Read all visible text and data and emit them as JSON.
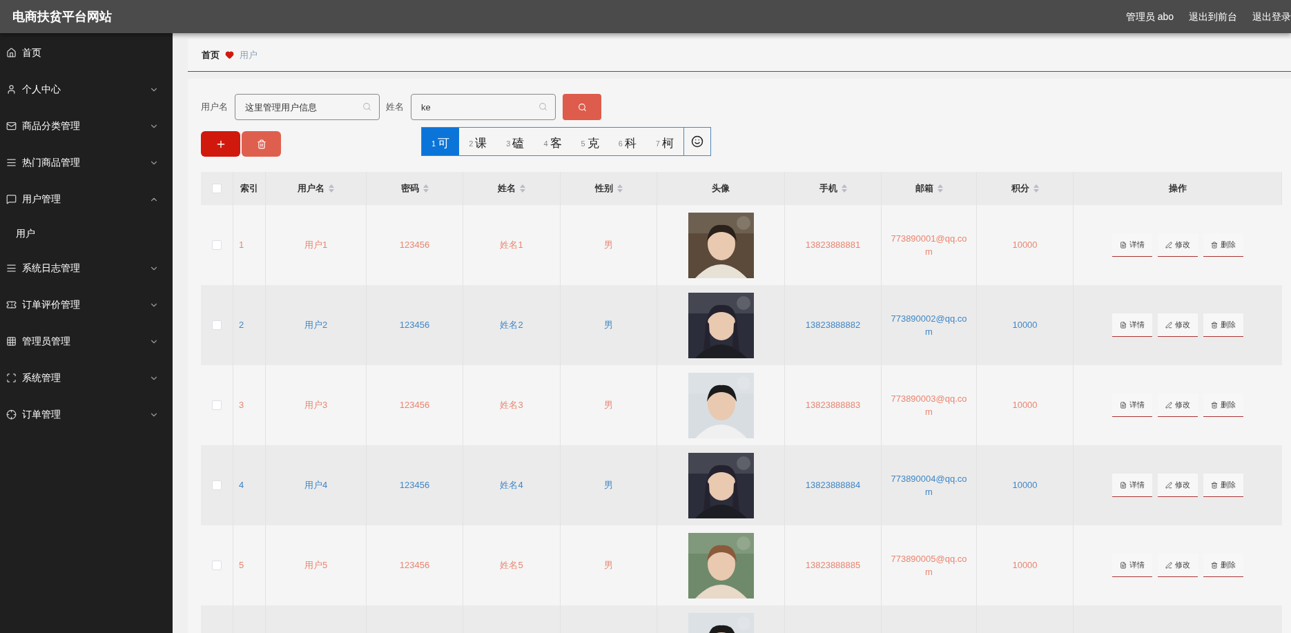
{
  "header": {
    "title": "电商扶贫平台网站",
    "links": [
      {
        "label": "管理员 abo"
      },
      {
        "label": "退出到前台"
      },
      {
        "label": "退出登录"
      }
    ]
  },
  "sidebar": {
    "items": [
      {
        "label": "首页"
      },
      {
        "label": "个人中心",
        "expanded": false
      },
      {
        "label": "商品分类管理",
        "expanded": false
      },
      {
        "label": "热门商品管理",
        "expanded": false
      },
      {
        "label": "用户管理",
        "expanded": true,
        "children": [
          {
            "label": "用户"
          }
        ]
      },
      {
        "label": "系统日志管理",
        "expanded": false
      },
      {
        "label": "订单评价管理",
        "expanded": false
      },
      {
        "label": "管理员管理",
        "expanded": false
      },
      {
        "label": "系统管理",
        "expanded": false
      },
      {
        "label": "订单管理",
        "expanded": false
      }
    ]
  },
  "breadcrumb": {
    "home": "首页",
    "current": "用户"
  },
  "search": {
    "fields": [
      {
        "label": "用户名",
        "placeholder": "这里管理用户信息"
      },
      {
        "label": "姓名",
        "value": "ke"
      }
    ]
  },
  "ime": {
    "candidates": [
      {
        "number": "1",
        "char": "可",
        "selected": true
      },
      {
        "number": "2",
        "char": "课",
        "selected": false
      },
      {
        "number": "3",
        "char": "磕",
        "selected": false
      },
      {
        "number": "4",
        "char": "客",
        "selected": false
      },
      {
        "number": "5",
        "char": "克",
        "selected": false
      },
      {
        "number": "6",
        "char": "科",
        "selected": false
      },
      {
        "number": "7",
        "char": "柯",
        "selected": false
      }
    ]
  },
  "table": {
    "select_all_checked": false,
    "columns": [
      {
        "label": "索引",
        "sortable": false
      },
      {
        "label": "用户名",
        "sortable": true
      },
      {
        "label": "密码",
        "sortable": true
      },
      {
        "label": "姓名",
        "sortable": true
      },
      {
        "label": "性别",
        "sortable": true
      },
      {
        "label": "头像",
        "sortable": false
      },
      {
        "label": "手机",
        "sortable": true
      },
      {
        "label": "邮箱",
        "sortable": true
      },
      {
        "label": "积分",
        "sortable": true
      },
      {
        "label": "操作",
        "sortable": false
      }
    ],
    "rows": [
      {
        "checked": false,
        "cells": [
          "1",
          "用户1",
          "123456",
          "姓名1",
          "男"
        ],
        "avatar": {
          "kind": "picture"
        },
        "cells2": [
          "13823888881",
          "773890001@qq.com",
          "10000"
        ],
        "actions": [
          "详情",
          "修改",
          "删除"
        ]
      },
      {
        "checked": false,
        "cells": [
          "2",
          "用户2",
          "123456",
          "姓名2",
          "男"
        ],
        "avatar": {
          "kind": "picture"
        },
        "cells2": [
          "13823888882",
          "773890002@qq.com",
          "10000"
        ],
        "actions": [
          "详情",
          "修改",
          "删除"
        ]
      },
      {
        "checked": false,
        "cells": [
          "3",
          "用户3",
          "123456",
          "姓名3",
          "男"
        ],
        "avatar": {
          "kind": "picture"
        },
        "cells2": [
          "13823888883",
          "773890003@qq.com",
          "10000"
        ],
        "actions": [
          "详情",
          "修改",
          "删除"
        ]
      },
      {
        "checked": false,
        "cells": [
          "4",
          "用户4",
          "123456",
          "姓名4",
          "男"
        ],
        "avatar": {
          "kind": "picture"
        },
        "cells2": [
          "13823888884",
          "773890004@qq.com",
          "10000"
        ],
        "actions": [
          "详情",
          "修改",
          "删除"
        ]
      },
      {
        "checked": false,
        "cells": [
          "5",
          "用户5",
          "123456",
          "姓名5",
          "男"
        ],
        "avatar": {
          "kind": "picture"
        },
        "cells2": [
          "13823888885",
          "773890005@qq.com",
          "10000"
        ],
        "actions": [
          "详情",
          "修改",
          "删除"
        ]
      },
      {
        "avatar": {
          "kind": "picture"
        }
      }
    ]
  }
}
